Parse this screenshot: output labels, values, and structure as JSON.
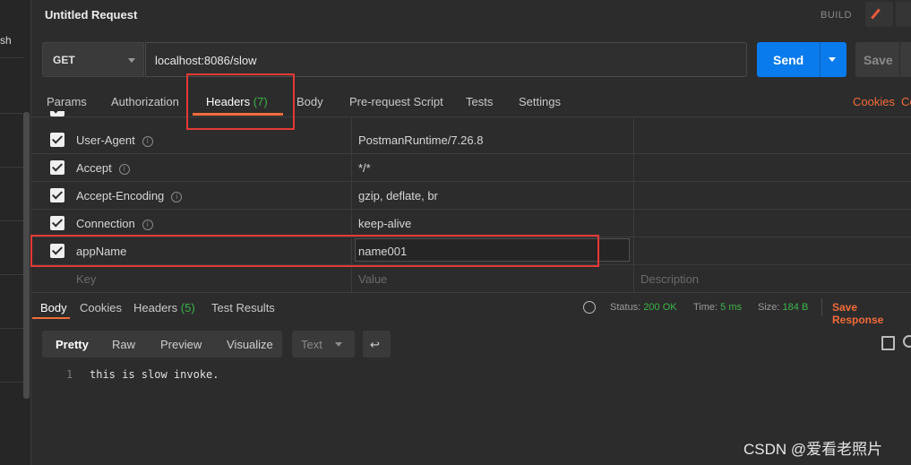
{
  "sidebar": {
    "partial_text": "sh"
  },
  "header": {
    "title": "Untitled Request",
    "build_label": "BUILD"
  },
  "request": {
    "method": "GET",
    "url": "localhost:8086/slow",
    "send_label": "Send",
    "save_label": "Save"
  },
  "request_tabs": {
    "params": "Params",
    "authorization": "Authorization",
    "headers": "Headers",
    "headers_count": "(7)",
    "body": "Body",
    "prerequest": "Pre-request Script",
    "tests": "Tests",
    "settings": "Settings",
    "cookies": "Cookies",
    "code": "Co"
  },
  "headers_table": {
    "rows": [
      {
        "key": "User-Agent",
        "value": "PostmanRuntime/7.26.8",
        "checked": true,
        "info": true
      },
      {
        "key": "Accept",
        "value": "*/*",
        "checked": true,
        "info": true
      },
      {
        "key": "Accept-Encoding",
        "value": "gzip, deflate, br",
        "checked": true,
        "info": true
      },
      {
        "key": "Connection",
        "value": "keep-alive",
        "checked": true,
        "info": true
      },
      {
        "key": "appName",
        "value": "name001",
        "checked": true,
        "info": false
      }
    ],
    "placeholders": {
      "key": "Key",
      "value": "Value",
      "description": "Description"
    }
  },
  "response": {
    "tabs": {
      "body": "Body",
      "cookies": "Cookies",
      "headers": "Headers",
      "headers_count": "(5)",
      "test_results": "Test Results"
    },
    "status_label": "Status:",
    "status_value": "200 OK",
    "time_label": "Time:",
    "time_value": "5 ms",
    "size_label": "Size:",
    "size_value": "184 B",
    "save_response": "Save Response",
    "formats": {
      "pretty": "Pretty",
      "raw": "Raw",
      "preview": "Preview",
      "visualize": "Visualize"
    },
    "language": "Text",
    "lines": [
      {
        "number": "1",
        "text": "this is slow invoke."
      }
    ]
  },
  "watermark": "CSDN @爱看老照片",
  "colors": {
    "accent": "#f26b3a",
    "send": "#097bed",
    "highlight": "#e53935",
    "status_ok": "#3bb54a"
  }
}
